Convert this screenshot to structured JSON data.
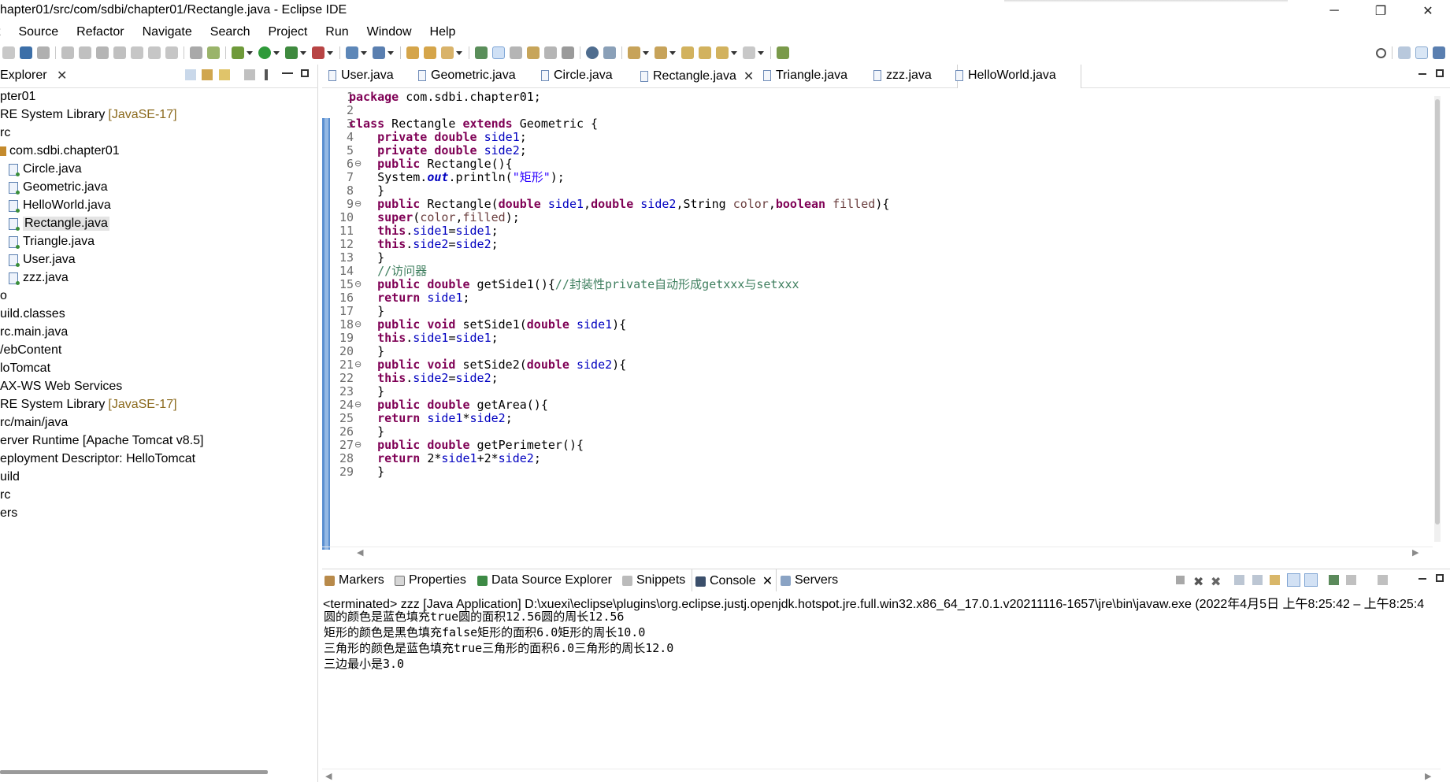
{
  "window": {
    "title": "hapter01/src/com/sdbi/chapter01/Rectangle.java - Eclipse IDE",
    "minimize": "─",
    "restore": "❐",
    "close": "✕"
  },
  "menu": [
    "t",
    "Source",
    "Refactor",
    "Navigate",
    "Search",
    "Project",
    "Run",
    "Window",
    "Help"
  ],
  "explorer": {
    "title": "Explorer",
    "close": "✕",
    "tree": [
      {
        "label": "pter01",
        "suffix": ""
      },
      {
        "label": "RE System Library",
        "suffix": "[JavaSE-17]"
      },
      {
        "label": "rc",
        "suffix": ""
      },
      {
        "label": "com.sdbi.chapter01",
        "suffix": ""
      },
      {
        "label": "Circle.java",
        "suffix": ""
      },
      {
        "label": "Geometric.java",
        "suffix": ""
      },
      {
        "label": "HelloWorld.java",
        "suffix": ""
      },
      {
        "label": "Rectangle.java",
        "suffix": ""
      },
      {
        "label": "Triangle.java",
        "suffix": ""
      },
      {
        "label": "User.java",
        "suffix": ""
      },
      {
        "label": "zzz.java",
        "suffix": ""
      },
      {
        "label": "o",
        "suffix": ""
      },
      {
        "label": "uild.classes",
        "suffix": ""
      },
      {
        "label": "rc.main.java",
        "suffix": ""
      },
      {
        "label": "/ebContent",
        "suffix": ""
      },
      {
        "label": "loTomcat",
        "suffix": ""
      },
      {
        "label": "AX-WS Web Services",
        "suffix": ""
      },
      {
        "label": "RE System Library",
        "suffix": "[JavaSE-17]"
      },
      {
        "label": "rc/main/java",
        "suffix": ""
      },
      {
        "label": "erver Runtime [Apache Tomcat v8.5]",
        "suffix": ""
      },
      {
        "label": "eployment Descriptor: HelloTomcat",
        "suffix": ""
      },
      {
        "label": "uild",
        "suffix": ""
      },
      {
        "label": "rc",
        "suffix": ""
      },
      {
        "label": "ers",
        "suffix": ""
      }
    ]
  },
  "editor": {
    "tabs": [
      {
        "label": "User.java"
      },
      {
        "label": "Geometric.java"
      },
      {
        "label": "Circle.java"
      },
      {
        "label": "Rectangle.java",
        "close": "✕"
      },
      {
        "label": "Triangle.java"
      },
      {
        "label": "zzz.java"
      },
      {
        "label": "HelloWorld.java"
      }
    ],
    "line_numbers": [
      "1",
      "2",
      "3",
      "4",
      "5",
      "6",
      "7",
      "8",
      "9",
      "10",
      "11",
      "12",
      "13",
      "14",
      "15",
      "16",
      "17",
      "18",
      "19",
      "20",
      "21",
      "22",
      "23",
      "24",
      "25",
      "26",
      "27",
      "28",
      "29"
    ],
    "code": [
      "package com.sdbi.chapter01;",
      "",
      "class Rectangle extends Geometric {",
      "    private double side1;",
      "    private double side2;",
      "    public Rectangle(){",
      "    System.out.println(\"矩形\");",
      "    }",
      "    public Rectangle(double side1,double side2,String color,boolean filled){",
      "    super(color,filled);",
      "    this.side1=side1;",
      "    this.side2=side2;",
      "    }",
      "    //访问器",
      "    public double getSide1(){//封装性private自动形成getxxx与setxxx",
      "    return side1;",
      "    }",
      "    public void setSide1(double side1){",
      "    this.side1=side1;",
      "    }",
      "    public void setSide2(double side2){",
      "    this.side2=side2;",
      "    }",
      "    public double getArea(){",
      "    return side1*side2;",
      "    }",
      "    public double getPerimeter(){",
      "    return 2*side1+2*side2;",
      "    }"
    ]
  },
  "console": {
    "tabs": [
      {
        "label": "Markers"
      },
      {
        "label": "Properties"
      },
      {
        "label": "Data Source Explorer"
      },
      {
        "label": "Snippets"
      },
      {
        "label": "Console",
        "close": "✕"
      },
      {
        "label": "Servers"
      }
    ],
    "status": "<terminated> zzz [Java Application] D:\\xuexi\\eclipse\\plugins\\org.eclipse.justj.openjdk.hotspot.jre.full.win32.x86_64_17.0.1.v20211116-1657\\jre\\bin\\javaw.exe  (2022年4月5日 上午8:25:42 – 上午8:25:4",
    "output": [
      "圆的颜色是蓝色填充true圆的面积12.56圆的周长12.56",
      "矩形的颜色是黑色填充false矩形的面积6.0矩形的周长10.0",
      "三角形的颜色是蓝色填充true三角形的面积6.0三角形的周长12.0",
      "三边最小是3.0"
    ]
  },
  "colors": {
    "keyword": "#7f0055",
    "field": "#0000c0",
    "string": "#2a00ff",
    "comment": "#3f7f5f",
    "gutter_change": "#5a8fd0"
  }
}
